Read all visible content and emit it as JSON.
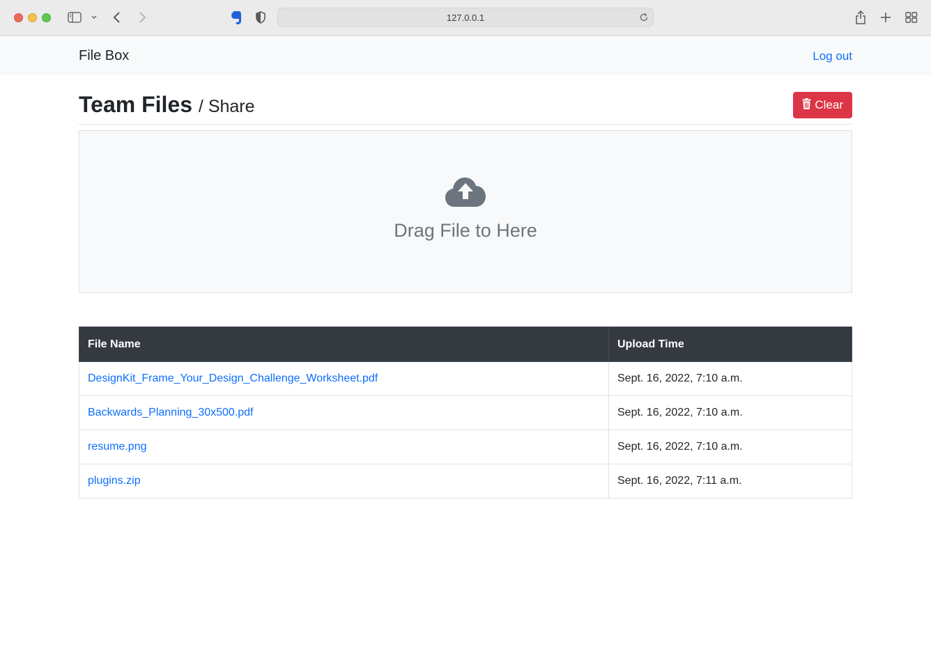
{
  "browser": {
    "url": "127.0.0.1",
    "icons": [
      "sidebar-icon",
      "chevron-down-icon",
      "back-icon",
      "forward-icon",
      "evernote-icon",
      "shield-icon",
      "reload-icon",
      "share-icon",
      "new-tab-icon",
      "tab-overview-icon"
    ]
  },
  "navbar": {
    "brand": "File Box",
    "logout_label": "Log out"
  },
  "header": {
    "title": "Team Files",
    "subtitle": "/ Share",
    "clear_button_label": "Clear",
    "clear_icon": "trash-icon"
  },
  "dropzone": {
    "icon": "cloud-upload-icon",
    "label": "Drag File to Here"
  },
  "table": {
    "columns": [
      "File Name",
      "Upload Time"
    ],
    "rows": [
      {
        "name": "DesignKit_Frame_Your_Design_Challenge_Worksheet.pdf",
        "time": "Sept. 16, 2022, 7:10 a.m."
      },
      {
        "name": "Backwards_Planning_30x500.pdf",
        "time": "Sept. 16, 2022, 7:10 a.m."
      },
      {
        "name": "resume.png",
        "time": "Sept. 16, 2022, 7:10 a.m."
      },
      {
        "name": "plugins.zip",
        "time": "Sept. 16, 2022, 7:11 a.m."
      }
    ]
  },
  "colors": {
    "link": "#0d6efd",
    "danger": "#dc3545",
    "table_header_bg": "#343a40",
    "muted": "#6c757d"
  }
}
